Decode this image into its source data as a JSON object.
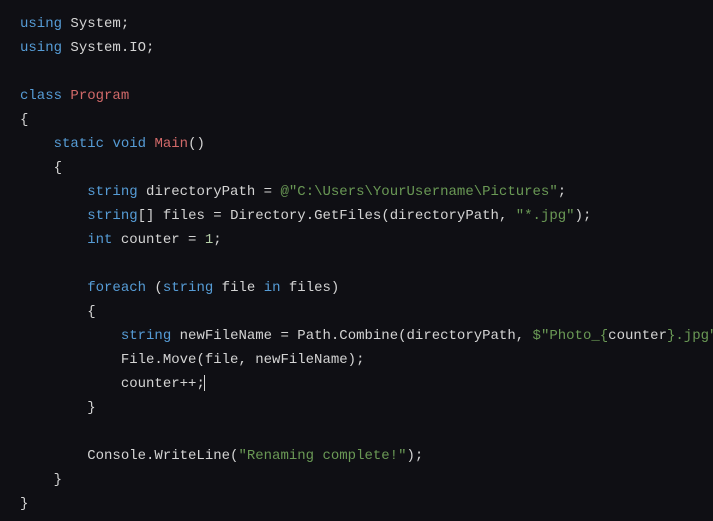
{
  "code": {
    "l1_kw1": "using",
    "l1_id": "System",
    "punct_semi": ";",
    "l2_kw1": "using",
    "l2_id": "System.IO",
    "l4_kw": "class",
    "l4_name": "Program",
    "open_brace": "{",
    "close_brace": "}",
    "l6_kw1": "static",
    "l6_kw2": "void",
    "l6_name": "Main",
    "l6_parens": "()",
    "l8_kw": "string",
    "l8_id": "directoryPath",
    "eq": " = ",
    "at": "@",
    "l8_str": "\"C:\\Users\\YourUsername\\Pictures\"",
    "l9_kw": "string",
    "l9_brackets": "[]",
    "l9_id": "files",
    "l9_rhs1": "Directory.GetFiles(directoryPath, ",
    "l9_str": "\"*.jpg\"",
    "l9_rhs2": ")",
    "l10_kw": "int",
    "l10_id": "counter",
    "l10_val": "1",
    "l12_kw": "foreach",
    "l12_open": " (",
    "l12_kw2": "string",
    "l12_id": "file",
    "l12_kw3": "in",
    "l12_id2": "files",
    "l12_close": ")",
    "l14_kw": "string",
    "l14_id": "newFileName",
    "l14_rhs1": "Path.Combine(directoryPath, ",
    "l14_dollar": "$",
    "l14_str1": "\"Photo_",
    "l14_interp_open": "{",
    "l14_interp_id": "counter",
    "l14_interp_close": "}",
    "l14_str2": ".jpg\"",
    "l14_rhs2": ")",
    "l15": "File.Move(file, newFileName)",
    "l16": "counter++",
    "l19_lhs": "Console.WriteLine(",
    "l19_str": "\"Renaming complete!\"",
    "l19_rhs": ")"
  }
}
